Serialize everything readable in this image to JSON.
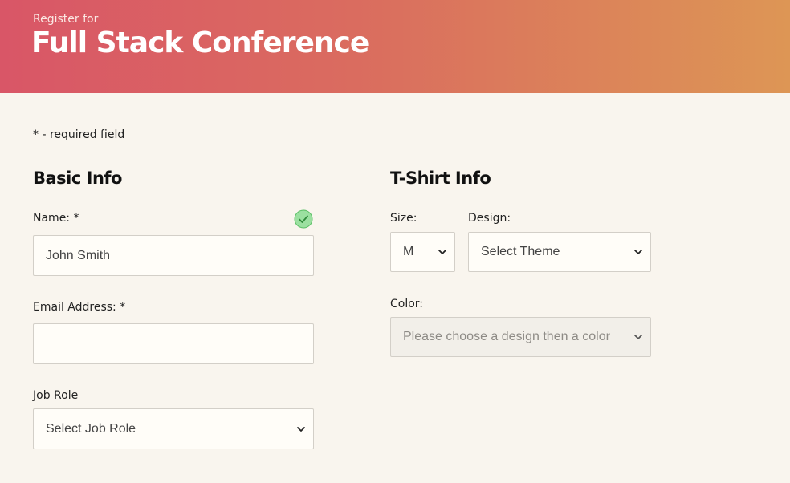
{
  "header": {
    "pretitle": "Register for",
    "title": "Full Stack Conference"
  },
  "required_note": "* - required field",
  "basic_info": {
    "title": "Basic Info",
    "name": {
      "label": "Name: *",
      "value": "John Smith",
      "valid": true
    },
    "email": {
      "label": "Email Address: *",
      "value": ""
    },
    "job_role": {
      "label": "Job Role",
      "selected": "Select Job Role"
    }
  },
  "tshirt_info": {
    "title": "T-Shirt Info",
    "size": {
      "label": "Size:",
      "selected": "M"
    },
    "design": {
      "label": "Design:",
      "selected": "Select Theme"
    },
    "color": {
      "label": "Color:",
      "selected": "Please choose a design then a color",
      "disabled": true
    }
  },
  "icons": {
    "valid_check": "check-circle-icon",
    "select_arrow": "chevron-down-icon"
  },
  "colors": {
    "header_gradient_start": "#d95667",
    "header_gradient_end": "#dd9655",
    "background": "#f9f5ee",
    "valid_green": "#7ecf86"
  }
}
